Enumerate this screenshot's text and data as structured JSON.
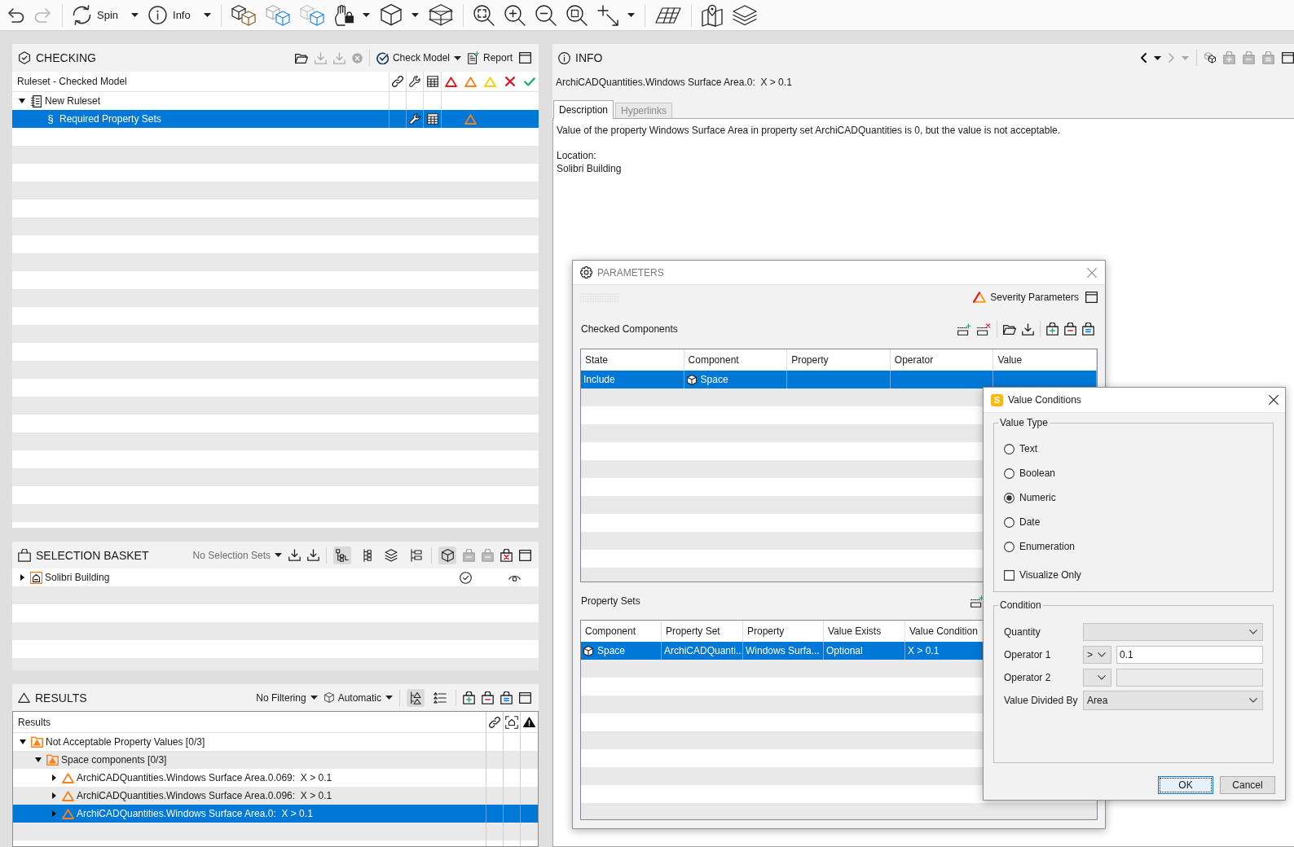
{
  "toolbar": {
    "undo": {
      "disabled": false
    },
    "redo": {
      "disabled": true
    },
    "spin_button": {
      "label": "Spin"
    },
    "info_button": {
      "label": "Info"
    }
  },
  "checking": {
    "title": "CHECKING",
    "tools": [
      {
        "disabled": false
      },
      {
        "disabled": true
      },
      {
        "disabled": true
      },
      {
        "disabled": true
      }
    ],
    "check_model_button": {
      "label": "Check Model"
    },
    "report_button": {
      "label": "Report"
    },
    "tree": {
      "column": "Ruleset - Checked Model",
      "rows": [
        {
          "kind": "ruleset",
          "label": "New Ruleset",
          "expanded": true,
          "selected": false,
          "children": [
            {
              "kind": "rule",
              "symbol": "§",
              "label": "Required Property Sets",
              "selected": true,
              "color": "#f5841f"
            }
          ]
        }
      ]
    }
  },
  "selection_basket": {
    "title": "SELECTION BASKET",
    "selection_sets": "No Selection Sets",
    "view_toggles": [
      {
        "pressed": true
      },
      {
        "pressed": false
      },
      {
        "pressed": false
      },
      {
        "pressed": false
      }
    ],
    "model_toggle": {
      "pressed": true
    },
    "basket_tools": [
      {
        "disabled": true
      },
      {
        "disabled": true
      },
      {
        "disabled": false
      }
    ],
    "rows": [
      {
        "label": "Solibri Building",
        "expanded": false,
        "selected": false
      }
    ]
  },
  "results": {
    "title": "RESULTS",
    "filter": "No Filtering",
    "mode": "Automatic",
    "view_toggles": [
      {
        "pressed": true
      },
      {
        "pressed": false
      }
    ],
    "column": "Results",
    "rows": [
      {
        "kind": "category",
        "label": "Not Acceptable Property Values [0/3]",
        "color": "#f5841f",
        "expanded": true,
        "selected": false,
        "children": [
          {
            "kind": "category",
            "label": "Space components [0/3]",
            "color": "#f5841f",
            "expanded": true,
            "selected": false,
            "children": [
              {
                "kind": "issue",
                "label": "ArchiCADQuantities.Windows Surface Area.0.069:  X > 0.1",
                "color": "#f5841f",
                "expanded": false,
                "selected": false
              },
              {
                "kind": "issue",
                "label": "ArchiCADQuantities.Windows Surface Area.0.096:  X > 0.1",
                "color": "#f5841f",
                "expanded": false,
                "selected": false
              },
              {
                "kind": "issue",
                "label": "ArchiCADQuantities.Windows Surface Area.0:  X > 0.1",
                "color": "#f5841f",
                "expanded": false,
                "selected": true
              }
            ]
          }
        ]
      }
    ]
  },
  "info": {
    "title": "INFO",
    "navigation": [
      {
        "disabled": false
      },
      {
        "disabled": false
      },
      {
        "disabled": true
      },
      {
        "disabled": true
      }
    ],
    "basket_tools": [
      {
        "disabled": true
      },
      {
        "disabled": true
      },
      {
        "disabled": true
      }
    ],
    "subject": "ArchiCADQuantities.Windows Surface Area.0:  X > 0.1",
    "tabs": [
      {
        "label": "Description",
        "selected": true
      },
      {
        "label": "Hyperlinks",
        "selected": false
      }
    ],
    "description": "Value of the property Windows Surface Area in property set ArchiCADQuantities is 0, but the value is not acceptable.",
    "location_label": "Location:",
    "location": "Solibri Building"
  },
  "parameters": {
    "title": "PARAMETERS",
    "severity_button": "Severity Parameters",
    "checked_components": {
      "label": "Checked Components",
      "columns": [
        "State",
        "Component",
        "Property",
        "Operator",
        "Value"
      ],
      "rows": [
        {
          "state": "Include",
          "component": "Space",
          "selected": true
        }
      ]
    },
    "property_sets": {
      "label": "Property Sets",
      "columns": [
        "Component",
        "Property Set",
        "Property",
        "Value Exists",
        "Value Condition"
      ],
      "rows": [
        {
          "component": "Space",
          "property_set": "ArchiCADQuanti...",
          "property": "Windows Surfa...",
          "value_exists": "Optional",
          "value_condition": "X > 0.1",
          "selected": true
        }
      ]
    }
  },
  "value_conditions": {
    "logo": "S",
    "title": "Value Conditions",
    "value_type": {
      "label": "Value Type",
      "options": [
        {
          "label": "Text",
          "selected": false
        },
        {
          "label": "Boolean",
          "selected": false
        },
        {
          "label": "Numeric",
          "selected": true
        },
        {
          "label": "Date",
          "selected": false
        },
        {
          "label": "Enumeration",
          "selected": false
        }
      ]
    },
    "visualize_only": {
      "label": "Visualize Only",
      "checked": false
    },
    "condition": {
      "label": "Condition",
      "fields": [
        {
          "kind": "dropdown",
          "label": "Quantity"
        },
        {
          "kind": "operator",
          "label": "Operator 1",
          "operator": ">",
          "value": "0.1",
          "disabled": false
        },
        {
          "kind": "operator",
          "label": "Operator 2",
          "disabled": true
        },
        {
          "kind": "dropdown",
          "label": "Value Divided By",
          "value": "Area"
        }
      ]
    },
    "buttons": [
      {
        "label": "OK",
        "default": true
      },
      {
        "label": "Cancel",
        "default": false
      }
    ]
  }
}
